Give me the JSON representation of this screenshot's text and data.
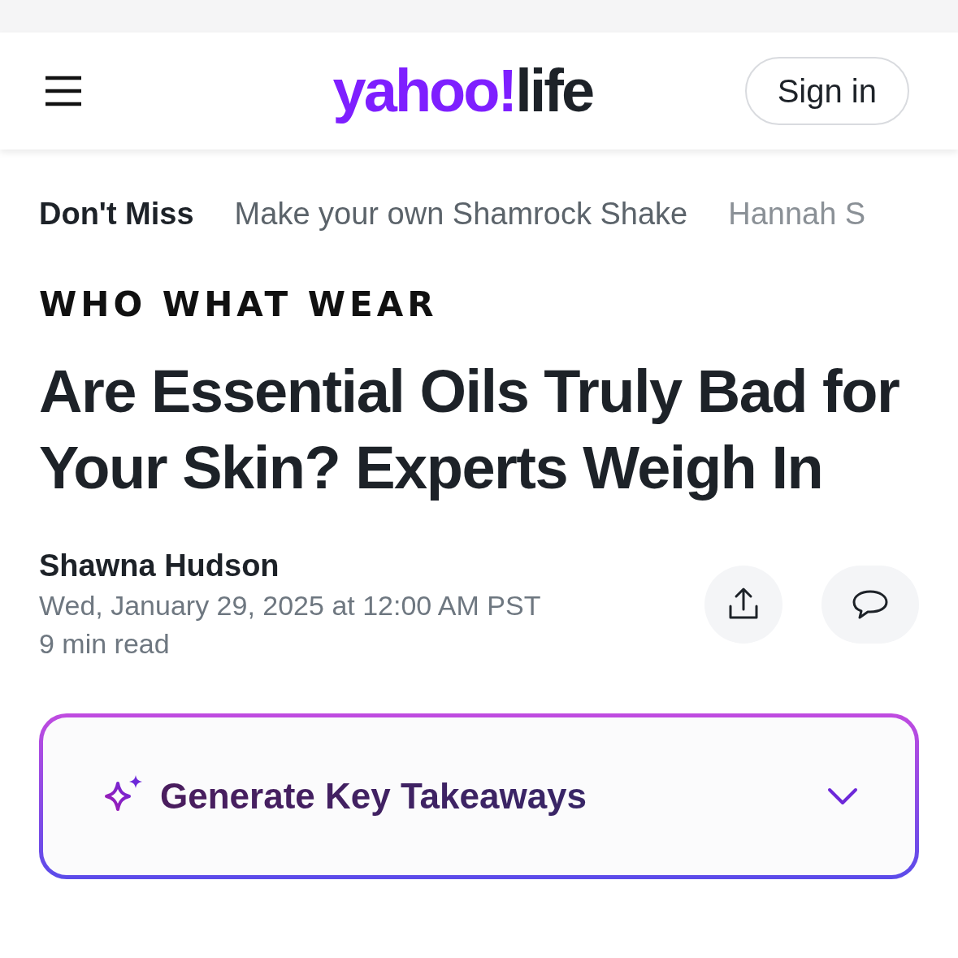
{
  "header": {
    "logo": {
      "brand": "yahoo!",
      "section": "life"
    },
    "sign_in": "Sign in"
  },
  "dont_miss": {
    "label": "Don't Miss",
    "links": [
      "Make your own Shamrock Shake",
      "Hannah S"
    ]
  },
  "article": {
    "publisher": "WHO WHAT WEAR",
    "title": "Are Essential Oils Truly Bad for Your Skin? Experts Weigh In",
    "author": "Shawna Hudson",
    "date": "Wed, January 29, 2025 at 12:00 AM PST",
    "read_time": "9 min read"
  },
  "key_takeaways": {
    "label": "Generate Key Takeaways",
    "expanded": false
  }
}
